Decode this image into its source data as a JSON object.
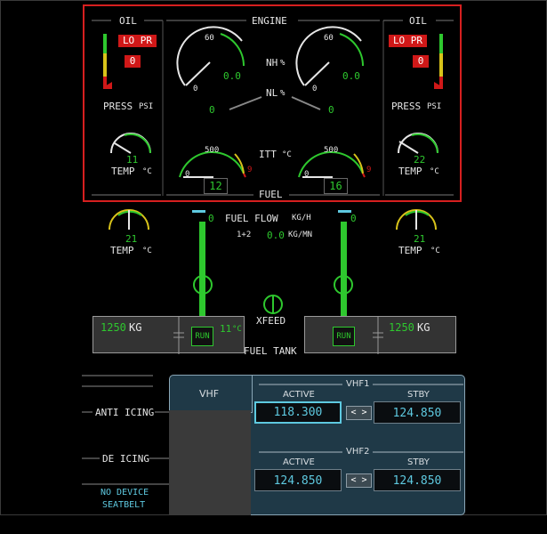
{
  "engine": {
    "title": "ENGINE",
    "fuel_title": "FUEL",
    "nh_label": "NH",
    "nl_label": "NL",
    "pct": "%",
    "itt_label": "ITT",
    "deg_c": "°C",
    "left": {
      "nh_scale_60": "60",
      "nh_scale_0": "0",
      "nh_value": "0.0",
      "nl_value": "0",
      "itt_scale_500": "500",
      "itt_scale_0": "0",
      "itt_scale_9": "9",
      "itt_value": "12"
    },
    "right": {
      "nh_scale_60": "60",
      "nh_scale_0": "0",
      "nh_value": "0.0",
      "nl_value": "0",
      "itt_scale_500": "500",
      "itt_scale_0": "0",
      "itt_scale_9": "9",
      "itt_value": "16"
    }
  },
  "oil": {
    "left": {
      "title": "OIL",
      "warning": "LO PR",
      "press_value": "0",
      "press_label": "PRESS",
      "psi": "PSI",
      "temp_value": "11",
      "temp_label": "TEMP",
      "deg_c": "°C"
    },
    "right": {
      "title": "OIL",
      "warning": "LO PR",
      "press_value": "0",
      "press_label": "PRESS",
      "psi": "PSI",
      "temp_value": "22",
      "temp_label": "TEMP",
      "deg_c": "°C"
    }
  },
  "fuel": {
    "flow_label": "FUEL FLOW",
    "flow_unit": "KG/H",
    "flow_left": "0",
    "flow_right": "0",
    "total_label": "1+2",
    "total_value": "0.0",
    "total_unit": "KG/MN",
    "left_temp_value": "21",
    "right_temp_value": "21",
    "temp_label": "TEMP",
    "deg_c": "°C",
    "xfeed_label": "XFEED",
    "tank_label": "FUEL TANK",
    "left_tank_qty": "1250",
    "right_tank_qty": "1250",
    "kg": "KG",
    "tank_temp_value": "11",
    "run_left": "RUN",
    "run_right": "RUN"
  },
  "alerts": {
    "anti_icing": "ANTI ICING",
    "de_icing": "DE ICING",
    "no_device": "NO DEVICE",
    "seatbelt": "SEATBELT"
  },
  "radio": {
    "tab_label": "VHF",
    "vhf1": {
      "title": "VHF1",
      "active_label": "ACTIVE",
      "stby_label": "STBY",
      "active_freq": "118.300",
      "stby_freq": "124.850",
      "swap": "< >"
    },
    "vhf2": {
      "title": "VHF2",
      "active_label": "ACTIVE",
      "stby_label": "STBY",
      "active_freq": "124.850",
      "stby_freq": "124.850",
      "swap": "< >"
    }
  },
  "colors": {
    "green": "#2ec82e",
    "red": "#d01818",
    "amber": "#d8c31a",
    "cyan": "#5ec9e0",
    "panel": "#1f3947"
  }
}
